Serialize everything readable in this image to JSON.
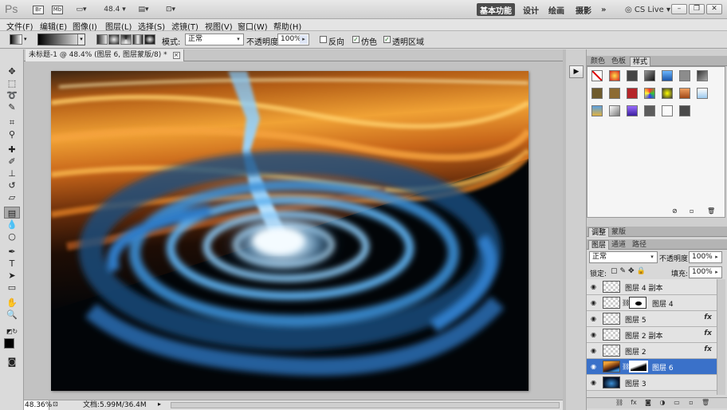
{
  "app": {
    "logo": "Ps",
    "bridge_label": "Br",
    "minibridge_label": "Mb",
    "zoom_display": "48.4",
    "workspaces": [
      "基本功能",
      "设计",
      "绘画",
      "摄影"
    ],
    "more_workspaces": "»",
    "cs_live": "CS Live",
    "window_controls": [
      "–",
      "❐",
      "✕"
    ]
  },
  "menu": [
    "文件(F)",
    "编辑(E)",
    "图像(I)",
    "图层(L)",
    "选择(S)",
    "滤镜(T)",
    "视图(V)",
    "窗口(W)",
    "帮助(H)"
  ],
  "options": {
    "mode_label": "模式:",
    "mode_value": "正常",
    "opacity_label": "不透明度:",
    "opacity_value": "100%",
    "reverse_label": "反向",
    "reverse_checked": false,
    "dither_label": "仿色",
    "dither_checked": true,
    "transparency_label": "透明区域",
    "transparency_checked": true
  },
  "document": {
    "tab_title": "未标题-1 @ 48.4% (图层 6, 图层蒙版/8) *",
    "close_glyph": "×",
    "zoom": "48.36%",
    "info": "文档:5.99M/36.4M"
  },
  "panels": {
    "top_tabs": [
      "颜色",
      "色板",
      "样式"
    ],
    "top_active": "样式",
    "mid_tabs": [
      "调整",
      "蒙版"
    ],
    "layer_tabs": [
      "图层",
      "通道",
      "路径"
    ],
    "layer_active": "图层",
    "blend_mode": "正常",
    "opacity_label": "不透明度:",
    "opacity_value": "100%",
    "lock_label": "锁定:",
    "fill_label": "填充:",
    "fill_value": "100%"
  },
  "layers": [
    {
      "name": "图层 4 副本",
      "fx": false,
      "selected": false,
      "mask": false
    },
    {
      "name": "图层 4",
      "fx": false,
      "selected": false,
      "mask": true
    },
    {
      "name": "图层 5",
      "fx": true,
      "selected": false,
      "mask": false
    },
    {
      "name": "图层 2 副本",
      "fx": true,
      "selected": false,
      "mask": false
    },
    {
      "name": "图层 2",
      "fx": true,
      "selected": false,
      "mask": false
    },
    {
      "name": "图层 6",
      "fx": false,
      "selected": true,
      "mask": true
    },
    {
      "name": "图层 3",
      "fx": false,
      "selected": false,
      "mask": false
    }
  ],
  "fx_label": "fx",
  "colors": {
    "selection": "#3a71c9",
    "sky_orange": "#e8922a",
    "galaxy_blue": "#3b8fd6"
  }
}
